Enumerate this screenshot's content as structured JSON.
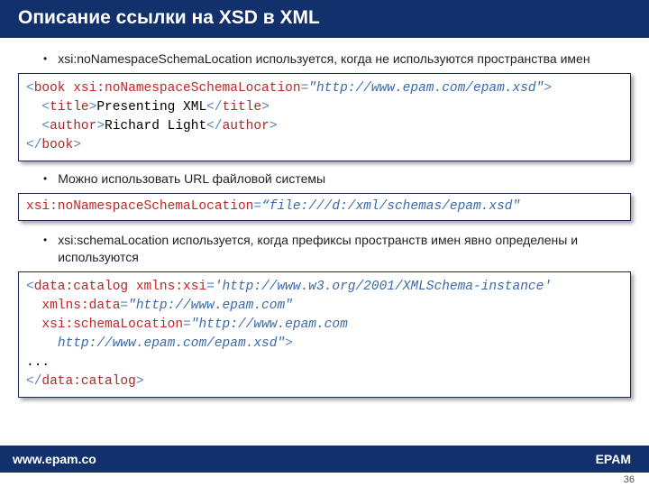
{
  "header": {
    "title": "Описание ссылки на XSD в XML"
  },
  "bullets": {
    "b1": "xsi:noNamespaceSchemaLocation используется, когда не используются пространства имен",
    "b2": "Можно использовать URL файловой системы",
    "b3": "xsi:schemaLocation используется, когда префиксы пространств имен явно определены и используются"
  },
  "code1": {
    "l1_open": "<",
    "l1_tag": "book",
    "l1_sp": " ",
    "l1_attr": "xsi:noNamespaceSchemaLocation",
    "l1_eq": "=",
    "l1_val": "\"http://www.epam.com/epam.xsd\"",
    "l1_close": ">",
    "l2_indent": "  ",
    "l2_o": "<",
    "l2_tag": "title",
    "l2_c": ">",
    "l2_txt": "Presenting XML",
    "l2_o2": "</",
    "l2_c2": ">",
    "l3_indent": "  ",
    "l3_o": "<",
    "l3_tag": "author",
    "l3_c": ">",
    "l3_txt": "Richard Light",
    "l3_o2": "</",
    "l3_c2": ">",
    "l4_o": "</",
    "l4_tag": "book",
    "l4_c": ">"
  },
  "code2": {
    "attr": "xsi:noNamespaceSchemaLocation",
    "eq": "=",
    "val": "“file:///d:/xml/schemas/epam.xsd\""
  },
  "code3": {
    "l1_o": "<",
    "l1_tag": "data:catalog",
    "l1_sp": " ",
    "l1_a1": "xmlns:xsi",
    "l1_eq": "=",
    "l1_v1": "'http://www.w3.org/2001/XMLSchema-instance'",
    "l2_indent": "  ",
    "l2_a": "xmlns:data",
    "l2_eq": "=",
    "l2_v": "\"http://www.epam.com\"",
    "l3_indent": "  ",
    "l3_a": "xsi:schemaLocation",
    "l3_eq": "=",
    "l3_v": "\"http://www.epam.com",
    "l4_indent": "    ",
    "l4_v": "http://www.epam.com/epam.xsd\"",
    "l4_c": ">",
    "l5": "...",
    "l6_o": "</",
    "l6_tag": "data:catalog",
    "l6_c": ">"
  },
  "footer": {
    "left": "www.epam.co",
    "right": "EPAM"
  },
  "page": "36"
}
